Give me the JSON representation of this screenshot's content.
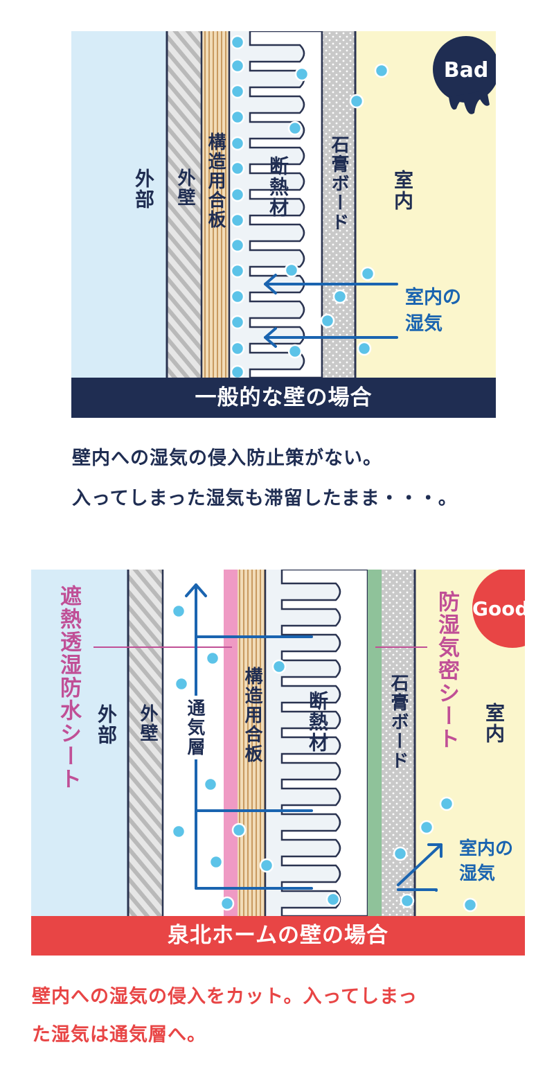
{
  "bad": {
    "badge": "Bad",
    "layers": {
      "outside": "外部",
      "outer_wall": "外壁",
      "plywood": "構造用合板",
      "insulation": "断熱材",
      "gypsum": "石膏ボード",
      "room": "室内"
    },
    "moisture_label_line1": "室内の",
    "moisture_label_line2": "湿気",
    "title_bar": "一般的な壁の場合",
    "caption_line1": "壁内への湿気の侵入防止策がない。",
    "caption_line2": "入ってしまった湿気も滞留したまま・・・。"
  },
  "good": {
    "badge": "Good",
    "layers": {
      "outside": "外部",
      "outer_wall": "外壁",
      "air_layer": "通気層",
      "plywood": "構造用合板",
      "insulation": "断熱材",
      "gypsum": "石膏ボード",
      "room": "室内"
    },
    "left_sheet_label": "遮熱透湿防水シート",
    "right_sheet_label": "防湿気密シート",
    "moisture_label_line1": "室内の",
    "moisture_label_line2": "湿気",
    "title_bar": "泉北ホームの壁の場合",
    "caption_line1": "壁内への湿気の侵入をカット。入ってしまっ",
    "caption_line2": "た湿気は通気層へ。"
  },
  "colors": {
    "navy": "#1f2d52",
    "red": "#e84545",
    "arrow_blue": "#1a64b0",
    "sheet_pink": "#c04f96",
    "outside_bg": "#d7ecf8",
    "room_bg": "#fbf6cc"
  }
}
